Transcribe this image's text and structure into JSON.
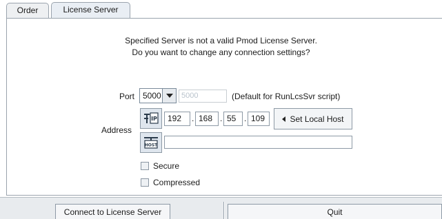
{
  "tabs": [
    {
      "label": "Order",
      "active": false
    },
    {
      "label": "License Server",
      "active": true
    }
  ],
  "message": {
    "line1": "Specified Server is not a valid Pmod License Server.",
    "line2": "Do you want to change any connection settings?"
  },
  "port": {
    "label": "Port",
    "selected": "5000",
    "field_value": "5000",
    "hint": "(Default for RunLcsSvr script)"
  },
  "address": {
    "label": "Address",
    "ip": [
      "192",
      "168",
      "55",
      "109"
    ],
    "ip_icon": "network-ip-icon",
    "host_icon": "host-icon",
    "host_value": "",
    "set_local_label": "Set Local Host"
  },
  "options": {
    "secure_label": "Secure",
    "secure_checked": false,
    "compressed_label": "Compressed",
    "compressed_checked": false
  },
  "buttons": {
    "connect_label": "Connect to License Server",
    "quit_label": "Quit"
  },
  "colors": {
    "tab_active_bg": "#e9eef4",
    "button_bg": "#f5f6f8",
    "border": "#8d99a5"
  }
}
